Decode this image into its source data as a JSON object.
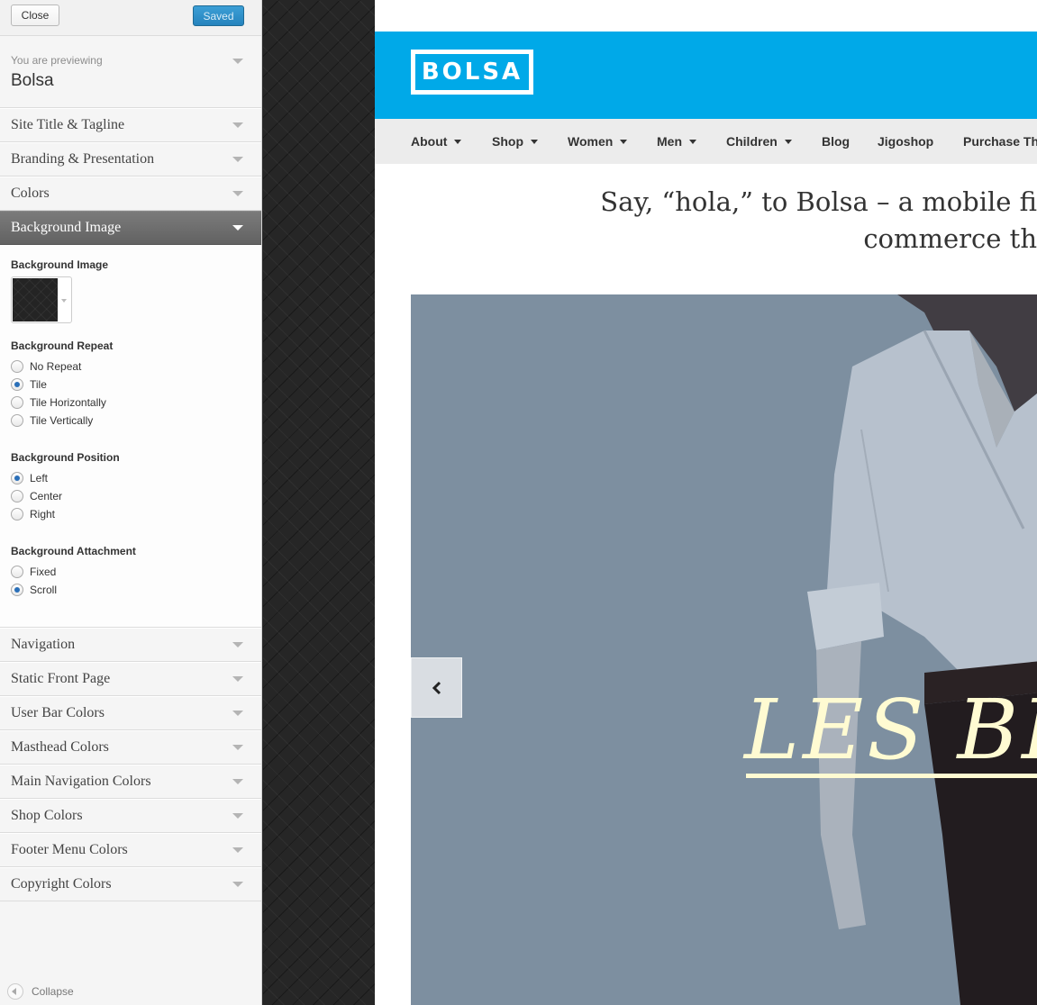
{
  "customizer": {
    "close_label": "Close",
    "saved_label": "Saved",
    "previewing_label": "You are previewing",
    "theme_name": "Bolsa",
    "sections_top": [
      {
        "label": "Site Title & Tagline"
      },
      {
        "label": "Branding & Presentation"
      },
      {
        "label": "Colors"
      }
    ],
    "active_section": {
      "label": "Background Image"
    },
    "background": {
      "image_label": "Background Image",
      "repeat": {
        "label": "Background Repeat",
        "options": [
          "No Repeat",
          "Tile",
          "Tile Horizontally",
          "Tile Vertically"
        ],
        "selected": "Tile"
      },
      "position": {
        "label": "Background Position",
        "options": [
          "Left",
          "Center",
          "Right"
        ],
        "selected": "Left"
      },
      "attachment": {
        "label": "Background Attachment",
        "options": [
          "Fixed",
          "Scroll"
        ],
        "selected": "Scroll"
      }
    },
    "sections_bottom": [
      {
        "label": "Navigation"
      },
      {
        "label": "Static Front Page"
      },
      {
        "label": "User Bar Colors"
      },
      {
        "label": "Masthead Colors"
      },
      {
        "label": "Main Navigation Colors"
      },
      {
        "label": "Shop Colors"
      },
      {
        "label": "Footer Menu Colors"
      },
      {
        "label": "Copyright Colors"
      }
    ],
    "collapse_label": "Collapse"
  },
  "site": {
    "logo_text": "BOLSA",
    "nav": [
      {
        "label": "About",
        "dropdown": true
      },
      {
        "label": "Shop",
        "dropdown": true
      },
      {
        "label": "Women",
        "dropdown": true
      },
      {
        "label": "Men",
        "dropdown": true
      },
      {
        "label": "Children",
        "dropdown": true
      },
      {
        "label": "Blog",
        "dropdown": false
      },
      {
        "label": "Jigoshop",
        "dropdown": false
      },
      {
        "label": "Purchase Th",
        "dropdown": false
      }
    ],
    "tagline_line1": "Say, “hola,” to Bolsa – a mobile fi",
    "tagline_line2": "commerce th",
    "hero_text": "LES BE"
  },
  "colors": {
    "masthead": "#00a9e8",
    "saved_button": "#2583bd",
    "hero_bg": "#7d8fa0",
    "hero_text": "#fffbd2"
  },
  "icons": {
    "section_toggle": "chevron-down-icon",
    "collapse": "collapse-arrow-icon",
    "slider_prev": "chevron-left-icon"
  }
}
